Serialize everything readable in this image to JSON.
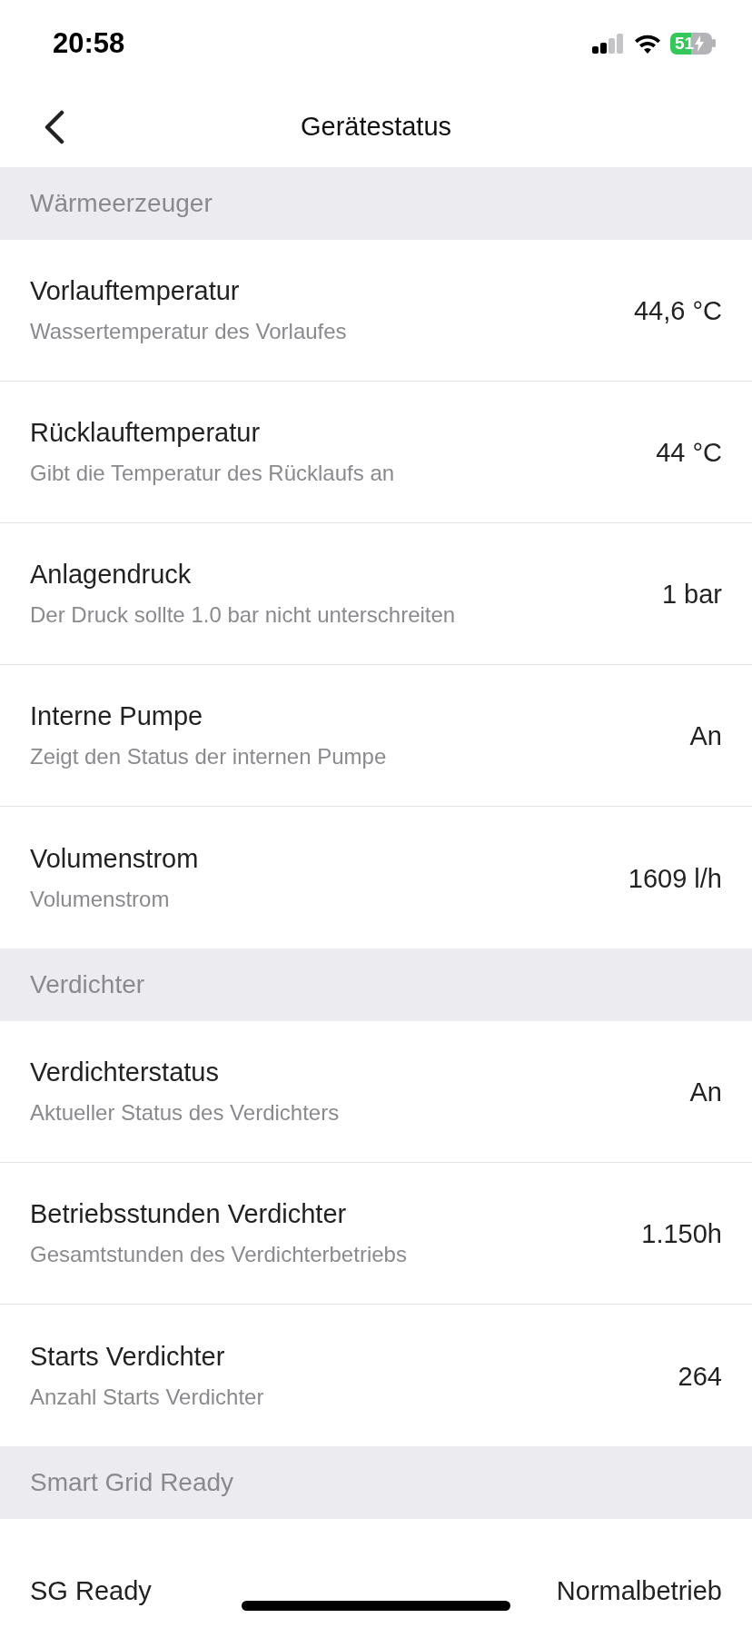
{
  "status_bar": {
    "time": "20:58",
    "battery": "51"
  },
  "nav": {
    "title": "Gerätestatus"
  },
  "sections": [
    {
      "title": "Wärmeerzeuger",
      "rows": [
        {
          "label": "Vorlauftemperatur",
          "description": "Wassertemperatur des Vorlaufes",
          "value": "44,6 °C"
        },
        {
          "label": "Rücklauftemperatur",
          "description": "Gibt die Temperatur des Rücklaufs an",
          "value": "44 °C"
        },
        {
          "label": "Anlagendruck",
          "description": "Der Druck sollte 1.0 bar nicht unterschreiten",
          "value": "1 bar"
        },
        {
          "label": "Interne Pumpe",
          "description": "Zeigt den Status der internen Pumpe",
          "value": "An"
        },
        {
          "label": "Volumenstrom",
          "description": "Volumenstrom",
          "value": "1609 l/h"
        }
      ]
    },
    {
      "title": "Verdichter",
      "rows": [
        {
          "label": "Verdichterstatus",
          "description": "Aktueller Status des Verdichters",
          "value": "An"
        },
        {
          "label": "Betriebsstunden Verdichter",
          "description": "Gesamtstunden des Verdichterbetriebs",
          "value": "1.150h"
        },
        {
          "label": "Starts Verdichter",
          "description": "Anzahl Starts Verdichter",
          "value": "264"
        }
      ]
    },
    {
      "title": "Smart Grid Ready",
      "rows": [
        {
          "label": "SG Ready",
          "value": "Normalbetrieb"
        }
      ]
    }
  ]
}
